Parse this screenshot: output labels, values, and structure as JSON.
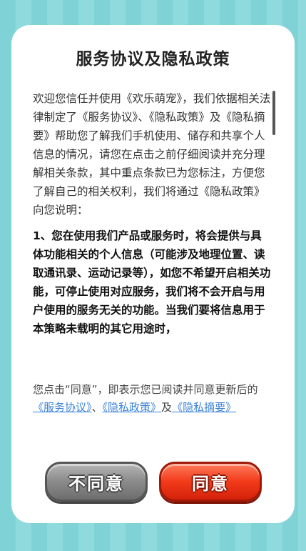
{
  "dialog": {
    "title": "服务协议及隐私政策",
    "body": [
      "欢迎您信任并使用《欢乐萌宠》，我们依据相关法律制定了《服务协议》、《隐私政策》及《隐私摘要》帮助您了解我们手机使用、储存和共享个人信息的情况，请您在点击之前仔细阅读并充分理解相关条款，其中重点条款已为您标注，方便您了解自己的相关权利，我们将通过《隐私政策》向您说明：",
      "1、您在使用我们产品或服务时，将会提供与具体功能相关的个人信息（可能涉及地理位置、读取通讯录、运动记录等），如您不希望开启相关功能，可停止使用对应服务，我们将不会开启与用户使用的服务无关的功能。当我们要将信息用于本策略未载明的其它用途时，"
    ],
    "consent": {
      "prefix": "您点击“同意”，即表示您已阅读并同意更新后的",
      "link_service": "《服务协议》",
      "sep1": "、",
      "link_privacy": "《隐私政策》",
      "sep2": "及",
      "link_summary": "《隐私摘要》"
    },
    "buttons": {
      "disagree": "不同意",
      "agree": "同意"
    }
  },
  "colors": {
    "background": "#7fd3d6",
    "link": "#3b82d6",
    "agree_button": "#f23b1a",
    "disagree_button": "#8e8e8e"
  }
}
